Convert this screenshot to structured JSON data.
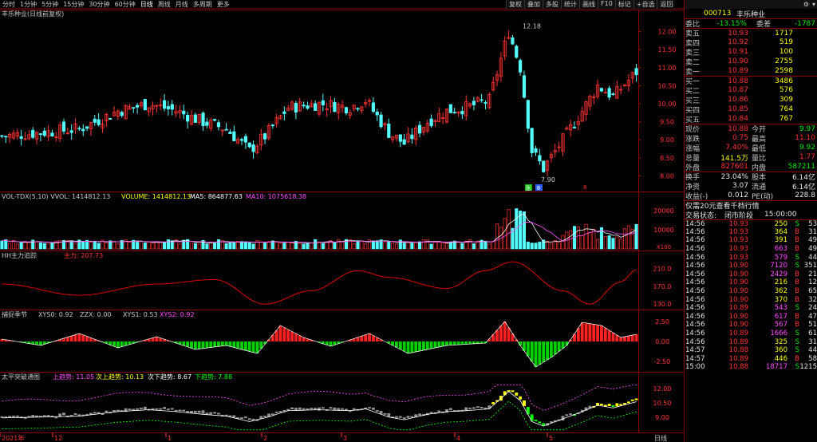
{
  "periods": [
    "分时",
    "1分钟",
    "5分钟",
    "15分钟",
    "30分钟",
    "60分钟",
    "日线",
    "周线",
    "月线",
    "多周期",
    "更多"
  ],
  "active_period": "日线",
  "toolbar": [
    "复权",
    "叠加",
    "多股",
    "统计",
    "画线",
    "F10",
    "标记",
    "+自选",
    "返回"
  ],
  "chart": {
    "stock_label": "丰乐种业(日线前复权)",
    "price_axis": [
      "12.00",
      "11.50",
      "11.00",
      "10.50",
      "10.00",
      "9.50",
      "9.00",
      "8.50",
      "8.00"
    ],
    "high_label": "12.18",
    "low_label": "7.90",
    "markers": [
      "涨",
      "8"
    ],
    "marker_right": "8",
    "vol_header": "VOL-TDX(5,10) VVOL: 1414812.13",
    "vol_volume": "VOLUME: 1414812.13",
    "vol_ma5": "MA5: 864877.63",
    "vol_ma10": "MA10: 1075618.38",
    "vol_axis": [
      "20000",
      "10000",
      "X100"
    ],
    "hh_title": "HH主力追踪",
    "hh_label": "主力: 207.73",
    "hh_axis": [
      "210.0",
      "170.0",
      "130.0"
    ],
    "cap_title": "捕捉季节",
    "cap_xys0": "XYS0: 0.92",
    "cap_zzx": "ZZX: 0.00",
    "cap_xys1": "XYS1: 0.53",
    "cap_xys2": "XYS2: 0.92",
    "cap_axis": [
      "2.50",
      "0.00",
      "-2.50"
    ],
    "tq_title": "太平突破通图",
    "tq_up": "上趋势: 11.05",
    "tq_up2": "次上趋势: 10.13",
    "tq_down2": "次下趋势: 8.67",
    "tq_down": "下趋势: 7.88",
    "tq_axis": [
      "12.00",
      "10.50",
      "9.00"
    ],
    "date_labels": [
      "2021年",
      "12",
      "1",
      "2",
      "3",
      "4",
      "5"
    ],
    "timeframe": "日线"
  },
  "panel": {
    "code": "000713",
    "name": "丰乐种业",
    "weibi_label": "委比",
    "weibi": "-13.15%",
    "weicha_label": "委差",
    "weicha": "-1787",
    "asks": [
      {
        "label": "卖五",
        "price": "10.93",
        "vol": "1717"
      },
      {
        "label": "卖四",
        "price": "10.92",
        "vol": "519"
      },
      {
        "label": "卖三",
        "price": "10.91",
        "vol": "100"
      },
      {
        "label": "卖二",
        "price": "10.90",
        "vol": "2755"
      },
      {
        "label": "卖一",
        "price": "10.89",
        "vol": "2598"
      }
    ],
    "bids": [
      {
        "label": "买一",
        "price": "10.88",
        "vol": "3486"
      },
      {
        "label": "买二",
        "price": "10.87",
        "vol": "576"
      },
      {
        "label": "买三",
        "price": "10.86",
        "vol": "309"
      },
      {
        "label": "买四",
        "price": "10.85",
        "vol": "764"
      },
      {
        "label": "买五",
        "price": "10.84",
        "vol": "767"
      }
    ],
    "quote": [
      {
        "l1": "现价",
        "v1": "10.88",
        "l2": "今开",
        "v2": "9.97",
        "c1": "red",
        "c2": "green"
      },
      {
        "l1": "涨跌",
        "v1": "0.75",
        "l2": "最高",
        "v2": "11.10",
        "c1": "red",
        "c2": "red"
      },
      {
        "l1": "涨幅",
        "v1": "7.40%",
        "l2": "最低",
        "v2": "9.92",
        "c1": "red",
        "c2": "green"
      },
      {
        "l1": "总量",
        "v1": "141.5万",
        "l2": "量比",
        "v2": "1.77",
        "c1": "yellow",
        "c2": "red"
      },
      {
        "l1": "外盘",
        "v1": "827601",
        "l2": "内盘",
        "v2": "587211",
        "c1": "red",
        "c2": "green"
      }
    ],
    "stats": [
      {
        "l1": "换手",
        "v1": "23.04%",
        "l2": "股本",
        "v2": "6.14亿"
      },
      {
        "l1": "净资",
        "v1": "3.07",
        "l2": "流通",
        "v2": "6.14亿"
      },
      {
        "l1": "收益(-)",
        "v1": "0.012",
        "l2": "PE(动)",
        "v2": "228.8"
      }
    ],
    "notice": "仅需20元查看千档行情",
    "status_label": "交易状态:",
    "status": "闭市阶段",
    "status_time": "15:00:00",
    "ticks": [
      {
        "t": "14:56",
        "p": "10.93",
        "v": "250",
        "s": "S",
        "n": "53",
        "pc": "red",
        "vc": "yellow"
      },
      {
        "t": "14:56",
        "p": "10.93",
        "v": "364",
        "s": "B",
        "n": "31",
        "pc": "red",
        "vc": "yellow"
      },
      {
        "t": "14:56",
        "p": "10.93",
        "v": "391",
        "s": "B",
        "n": "49",
        "pc": "red",
        "vc": "yellow"
      },
      {
        "t": "14:56",
        "p": "10.93",
        "v": "663",
        "s": "B",
        "n": "49",
        "pc": "red",
        "vc": "mag"
      },
      {
        "t": "14:56",
        "p": "10.93",
        "v": "579",
        "s": "S",
        "n": "44",
        "pc": "red",
        "vc": "mag"
      },
      {
        "t": "14:56",
        "p": "10.90",
        "v": "7120",
        "s": "S",
        "n": "351",
        "pc": "red",
        "vc": "mag"
      },
      {
        "t": "14:56",
        "p": "10.90",
        "v": "2429",
        "s": "B",
        "n": "21",
        "pc": "red",
        "vc": "mag"
      },
      {
        "t": "14:56",
        "p": "10.90",
        "v": "216",
        "s": "B",
        "n": "12",
        "pc": "red",
        "vc": "yellow"
      },
      {
        "t": "14:56",
        "p": "10.90",
        "v": "362",
        "s": "B",
        "n": "65",
        "pc": "red",
        "vc": "yellow"
      },
      {
        "t": "14:56",
        "p": "10.90",
        "v": "370",
        "s": "B",
        "n": "32",
        "pc": "red",
        "vc": "yellow"
      },
      {
        "t": "14:56",
        "p": "10.89",
        "v": "543",
        "s": "S",
        "n": "24",
        "pc": "red",
        "vc": "mag"
      },
      {
        "t": "14:56",
        "p": "10.90",
        "v": "617",
        "s": "B",
        "n": "47",
        "pc": "red",
        "vc": "mag"
      },
      {
        "t": "14:56",
        "p": "10.90",
        "v": "567",
        "s": "B",
        "n": "51",
        "pc": "red",
        "vc": "mag"
      },
      {
        "t": "14:56",
        "p": "10.89",
        "v": "1666",
        "s": "S",
        "n": "61",
        "pc": "red",
        "vc": "mag"
      },
      {
        "t": "14:56",
        "p": "10.89",
        "v": "325",
        "s": "S",
        "n": "31",
        "pc": "red",
        "vc": "yellow"
      },
      {
        "t": "14:57",
        "p": "10.88",
        "v": "360",
        "s": "S",
        "n": "44",
        "pc": "red",
        "vc": "yellow"
      },
      {
        "t": "14:57",
        "p": "10.89",
        "v": "446",
        "s": "B",
        "n": "58",
        "pc": "red",
        "vc": "yellow"
      },
      {
        "t": "15:00",
        "p": "10.88",
        "v": "18717",
        "s": "S",
        "n": "1215",
        "pc": "red",
        "vc": "mag"
      }
    ]
  }
}
